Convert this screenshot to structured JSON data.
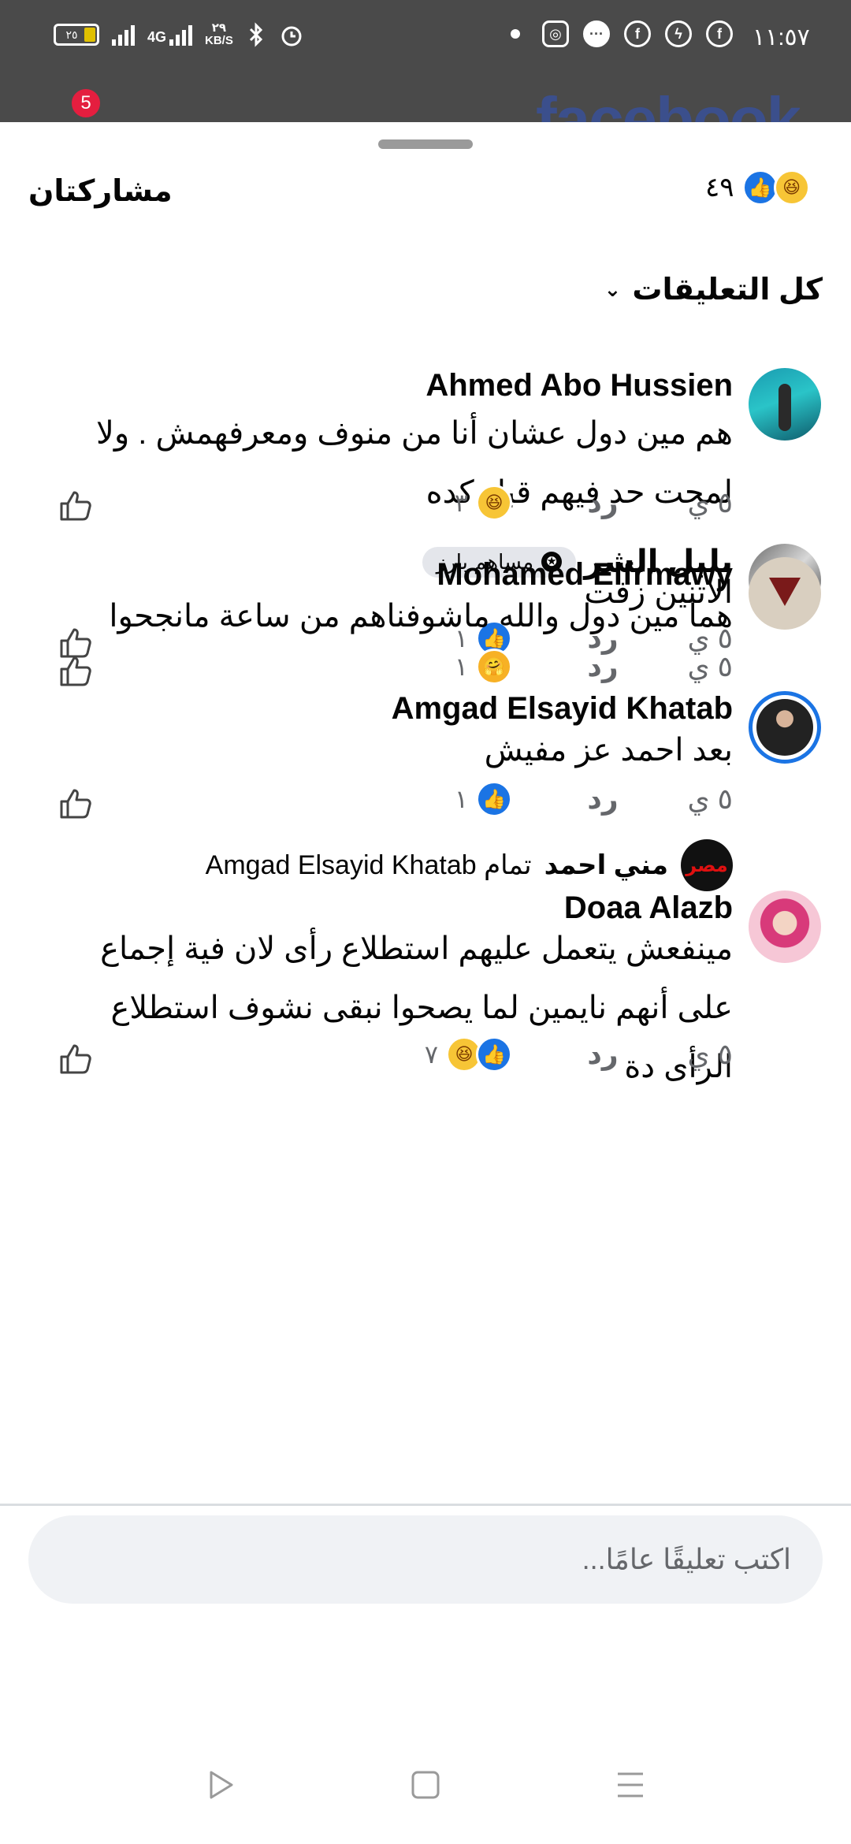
{
  "status_bar": {
    "time": "١١:٥٧",
    "battery": "٢٥",
    "network": "4G",
    "speed_value": "٢٩",
    "speed_unit": "KB/S"
  },
  "background_app": {
    "notification_count": "5",
    "brand": "facebook"
  },
  "sheet": {
    "title": "مشاركتان",
    "reaction_count": "٤٩",
    "filter_label": "كل التعليقات"
  },
  "comments": [
    {
      "author": "Ahmed Abo Hussien",
      "text": "هم مين دول عشان أنا من منوف ومعرفهمش . ولا لمحت حد فيهم قبل كده",
      "time": "٥ ي",
      "reply": "رد",
      "reaction_count": "٣",
      "reactions": [
        "haha"
      ]
    },
    {
      "author": "بلبل الشر",
      "badge": "مساهم بارز",
      "text": "الاتنين  زفت",
      "time": "٥ ي",
      "reply": "رد",
      "reaction_count": "١",
      "reactions": [
        "like"
      ]
    },
    {
      "author": "Mohamed Elfrmawy",
      "text": "هما مين دول والله ماشوفناهم من ساعة مانجحوا",
      "time": "٥ ي",
      "reply": "رد",
      "reaction_count": "١",
      "reactions": [
        "care"
      ]
    },
    {
      "author": "Amgad Elsayid Khatab",
      "text": "بعد احمد عز مفيش",
      "time": "٥ ي",
      "reply": "رد",
      "reaction_count": "١",
      "reactions": [
        "like"
      ]
    },
    {
      "author": "Doaa Alazb",
      "text": "مينفعش يتعمل عليهم استطلاع رأى لان فية إجماع على أنهم  نايمين لما يصحوا نبقى نشوف استطلاع الرأى دة",
      "time": "٥ ي",
      "reply": "رد",
      "reaction_count": "٧",
      "reactions": [
        "like",
        "haha"
      ]
    }
  ],
  "reply_preview": {
    "author": "مني احمد",
    "text": "تمام Amgad Elsayid Khatab",
    "avatar_text": "مصر"
  },
  "composer": {
    "placeholder": "اكتب تعليقًا عامًا..."
  },
  "icon_names": [
    "like-thumb-icon",
    "haha-emoji-icon",
    "care-emoji-icon",
    "chevron-down-icon",
    "star-badge-icon",
    "back-triangle-icon",
    "home-square-icon",
    "menu-lines-icon"
  ],
  "colors": {
    "like_blue": "#1b74e4",
    "haha_yellow": "#f7c536",
    "status_bar": "#4a4a4a",
    "secondary_text": "#65676b"
  }
}
